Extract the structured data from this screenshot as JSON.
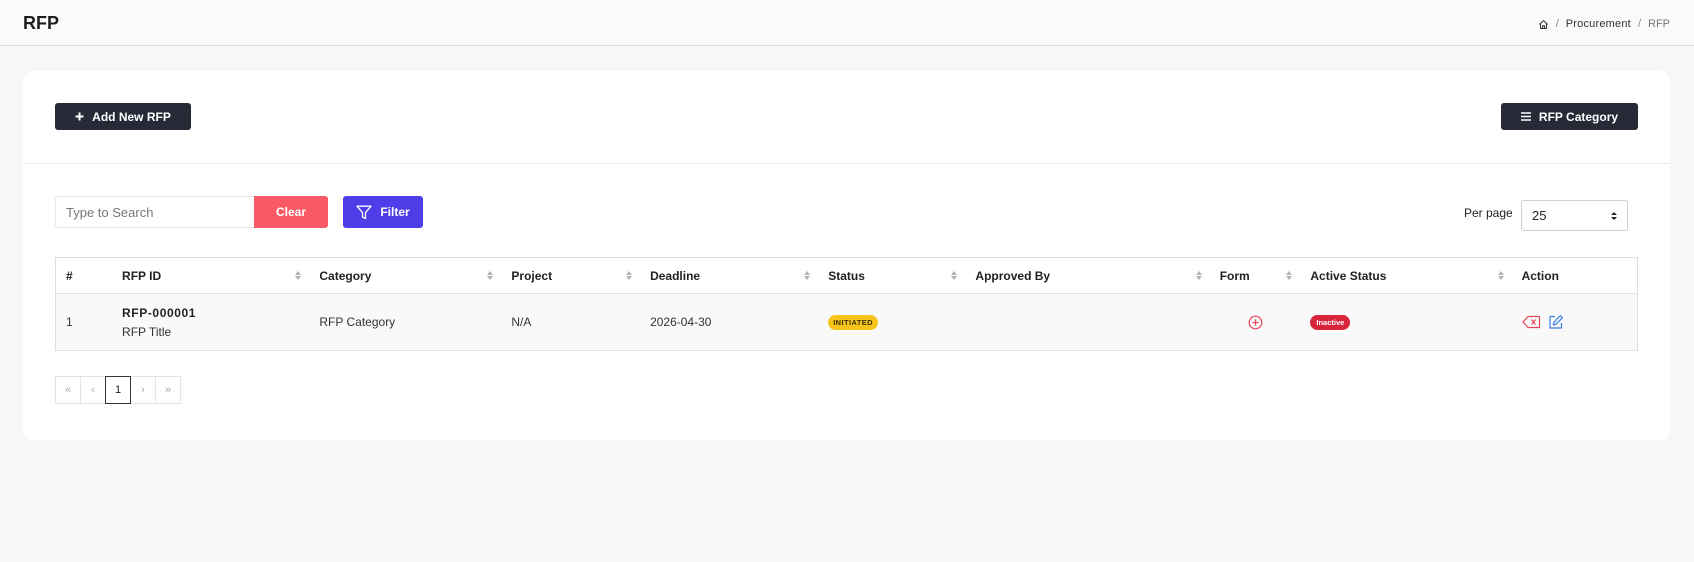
{
  "header": {
    "title": "RFP",
    "breadcrumb": {
      "home_icon": "home-icon",
      "separator": "/",
      "items": [
        "Procurement",
        "RFP"
      ]
    }
  },
  "toolbar": {
    "add_button_label": "Add New RFP",
    "category_button_label": "RFP Category"
  },
  "search": {
    "placeholder": "Type to Search",
    "value": "",
    "clear_label": "Clear",
    "filter_label": "Filter"
  },
  "per_page": {
    "label": "Per page",
    "value": "25"
  },
  "table": {
    "columns": [
      "#",
      "RFP ID",
      "Category",
      "Project",
      "Deadline",
      "Status",
      "Approved By",
      "Form",
      "Active Status",
      "Action"
    ],
    "rows": [
      {
        "index": "1",
        "rfp_id": "RFP-000001",
        "rfp_title": "RFP Title",
        "category": "RFP Category",
        "project": "N/A",
        "deadline": "2026-04-30",
        "status": "INITIATED",
        "approved_by": "",
        "active_status": "Inactive"
      }
    ]
  },
  "pagination": {
    "first": "«",
    "prev": "‹",
    "current": "1",
    "next": "›",
    "last": "»"
  },
  "colors": {
    "dark_button": "#252a36",
    "clear_button": "#fb5a65",
    "filter_button": "#4f3ee8",
    "status_initiated": "#f6c41b",
    "status_inactive": "#d9253b"
  }
}
